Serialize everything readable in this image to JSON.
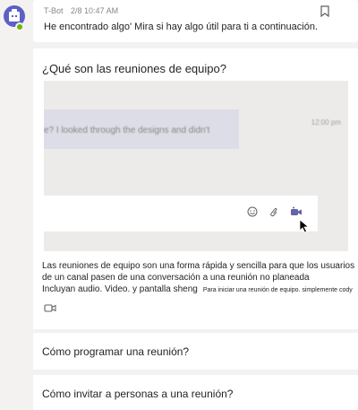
{
  "message": {
    "sender": "T-Bot",
    "timestamp": "2/8 10:47 AM",
    "text": "He encontrado algo' Mira si hay algo útil para ti a continuación.",
    "icons": {
      "avatar": "bot-avatar-icon",
      "status": "available-status-icon",
      "bookmark": "bookmark-icon"
    }
  },
  "article": {
    "title": "¿Qué son las reuniones de equipo?",
    "preview": {
      "message_text": "e? I looked through the designs and didn't",
      "time": "12:00 pm",
      "compose_icons": [
        "emoji-icon",
        "attach-icon",
        "meet-now-icon"
      ]
    },
    "description": {
      "line1": "Las reuniones de equipo son una forma rápida y sencilla para que los usuarios",
      "line2": "de un canal pasen de una conversación a una reunión no planeada",
      "line3": "Incluyan audio. Video. y pantalla sheng",
      "line3_small": "Para iniciar una reunión de equipo. simplemente cody"
    }
  },
  "links": [
    {
      "label": "Cómo programar una reunión?"
    },
    {
      "label": "Cómo invitar a personas a una reunión?"
    }
  ],
  "colors": {
    "background": "#f3f2f1",
    "card": "#ffffff",
    "accent": "#6264a7",
    "status": "#6bb700"
  }
}
